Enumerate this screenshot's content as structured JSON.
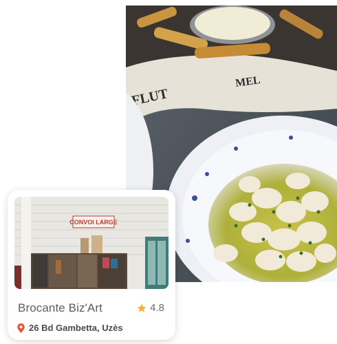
{
  "hero": {
    "image": "food-plate-photo"
  },
  "place": {
    "name": "Brocante Biz'Art",
    "rating": "4.8",
    "address": "26 Bd Gambetta, Uzès",
    "shop_sign": "CONVOI LARGE",
    "icons": {
      "rating": "star-icon",
      "address": "location-pin-icon"
    },
    "colors": {
      "star": "#f5b335",
      "pin": "#e4573d",
      "title": "#5d5d5d"
    }
  }
}
